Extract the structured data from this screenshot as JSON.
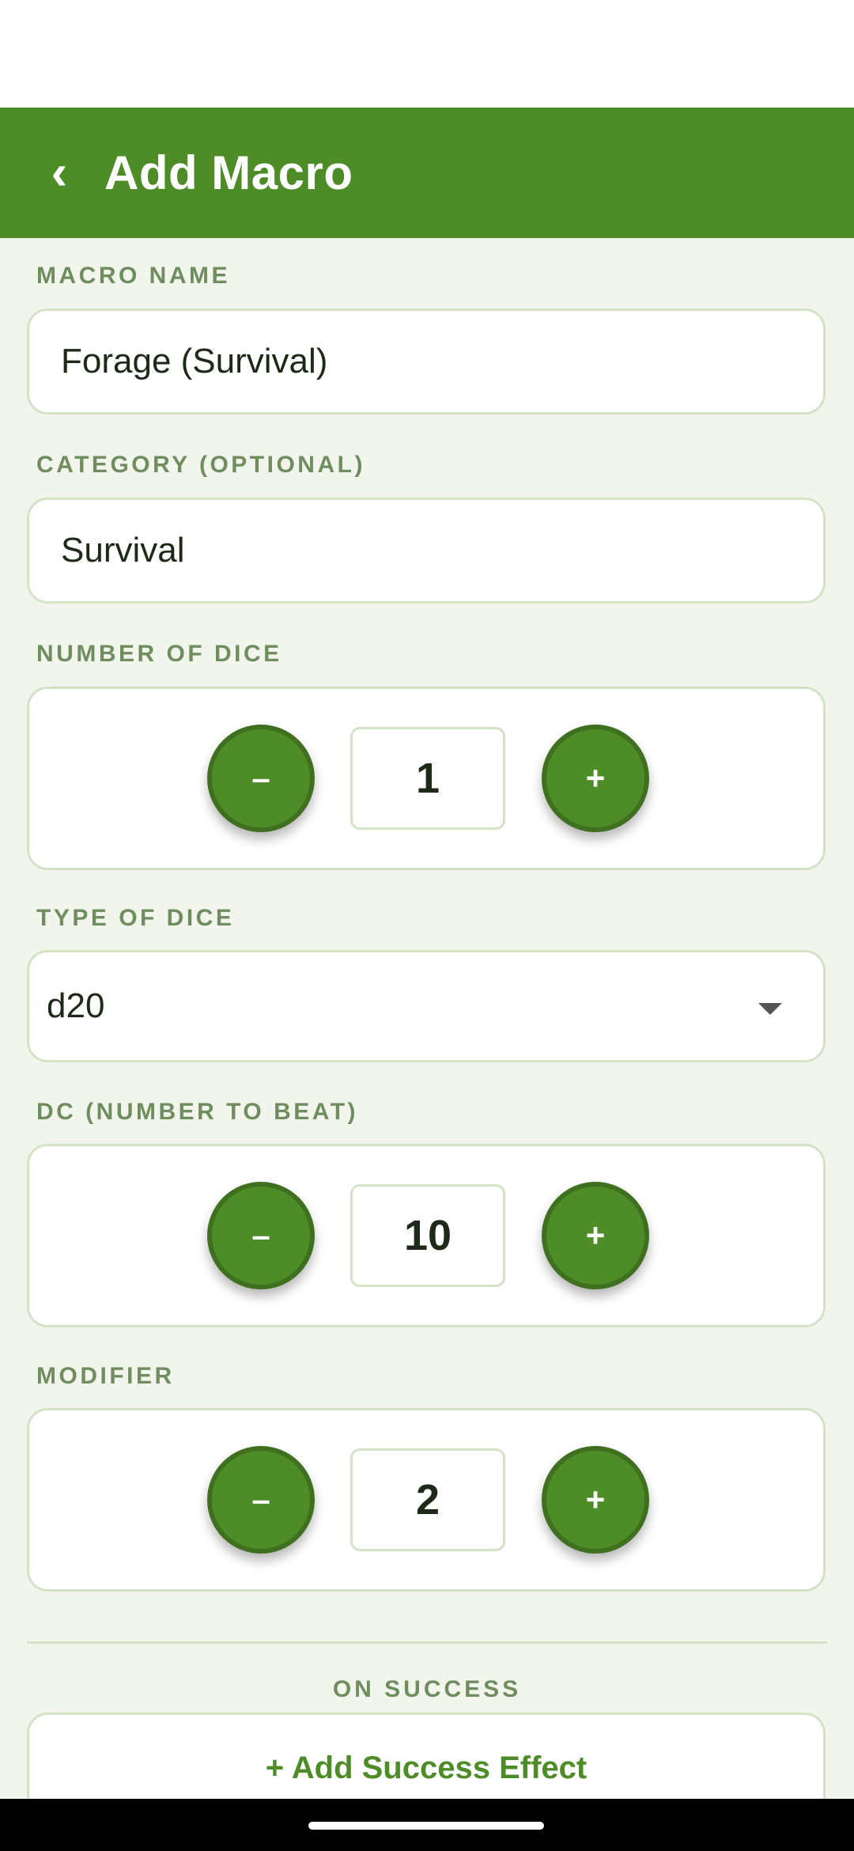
{
  "app_bar": {
    "back_icon_glyph": "‹",
    "title": "Add Macro"
  },
  "macro_name": {
    "label": "MACRO NAME",
    "value": "Forage (Survival)"
  },
  "category": {
    "label": "CATEGORY (OPTIONAL)",
    "value": "Survival"
  },
  "number_of_dice": {
    "label": "NUMBER OF DICE",
    "decrement_label": "–",
    "increment_label": "+",
    "value": "1"
  },
  "type_of_dice": {
    "label": "TYPE OF DICE",
    "selected": "d20"
  },
  "dc": {
    "label": "DC (NUMBER TO BEAT)",
    "decrement_label": "–",
    "increment_label": "+",
    "value": "10"
  },
  "modifier": {
    "label": "MODIFIER",
    "decrement_label": "–",
    "increment_label": "+",
    "value": "2"
  },
  "on_success": {
    "title": "ON SUCCESS",
    "add_button_label": "+ Add Success Effect"
  },
  "colors": {
    "primary": "#4e8c28",
    "primary_dark": "#3e7020",
    "background": "#f2f5ec",
    "label": "#6f8d5f",
    "border": "#d3e3c6"
  }
}
